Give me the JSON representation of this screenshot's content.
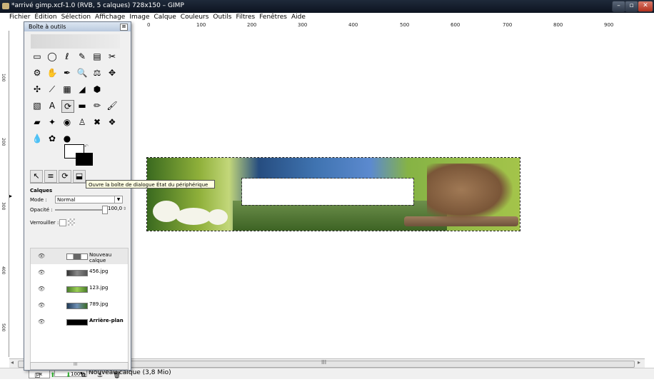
{
  "window": {
    "title": "*arrivé gimp.xcf-1.0 (RVB, 5 calques) 728x150 – GIMP",
    "controls": [
      "–",
      "▫",
      "✕"
    ]
  },
  "menubar": {
    "items": [
      "Fichier",
      "Édition",
      "Sélection",
      "Affichage",
      "Image",
      "Calque",
      "Couleurs",
      "Outils",
      "Filtres",
      "Fenêtres",
      "Aide"
    ]
  },
  "ruler": {
    "labels": [
      "0",
      "100",
      "200",
      "300",
      "400",
      "500",
      "600",
      "700",
      "800",
      "900"
    ],
    "left_labels": [
      "100",
      "200",
      "300",
      "400",
      "500"
    ]
  },
  "toolbox": {
    "title": "Boîte à outils",
    "close": "⊠",
    "tools": [
      [
        "▭",
        "◯",
        "ℓ",
        "✎",
        "▤",
        "✂"
      ],
      [
        "⚙",
        "✋",
        "✒",
        "🔍",
        "⚖",
        "✥"
      ],
      [
        "✣",
        "⟋",
        "▦",
        "◢",
        "⬢"
      ],
      [
        "▧",
        "A",
        "⟳",
        "▬",
        "✏",
        "🖌"
      ],
      [
        "▰",
        "✦",
        "◉",
        "♙",
        "✖",
        "❖"
      ],
      [
        "💧",
        "✿",
        "●"
      ]
    ],
    "tabs": [
      "↖",
      "≡",
      "⟳",
      "⬓"
    ]
  },
  "layers": {
    "heading": "Calques",
    "mode_label": "Mode :",
    "mode_value": "Normal",
    "opacity_label": "Opacité :",
    "opacity_value": "100,0",
    "opacity": 1.0,
    "lock_label": "Verrouiller :",
    "items": [
      {
        "name": "Nouveau calque",
        "bold": false,
        "active": true
      },
      {
        "name": "456.jpg",
        "bold": false,
        "active": false
      },
      {
        "name": "123.jpg",
        "bold": false,
        "active": false
      },
      {
        "name": "789.jpg",
        "bold": false,
        "active": false
      },
      {
        "name": "Arrière-plan",
        "bold": true,
        "active": false
      }
    ],
    "eye_icon": "👁",
    "buttons": [
      "▢",
      "⬆",
      "⬇",
      "⧉",
      "⚓",
      "🗑"
    ]
  },
  "tooltip": {
    "text": "Ouvre la boîte de dialogue État du périphérique"
  },
  "statusbar": {
    "unit": "px",
    "zoom": "100%",
    "message": "Nouveau calque (3,8 Mio)"
  },
  "scrollbar": {
    "grip": "III"
  }
}
